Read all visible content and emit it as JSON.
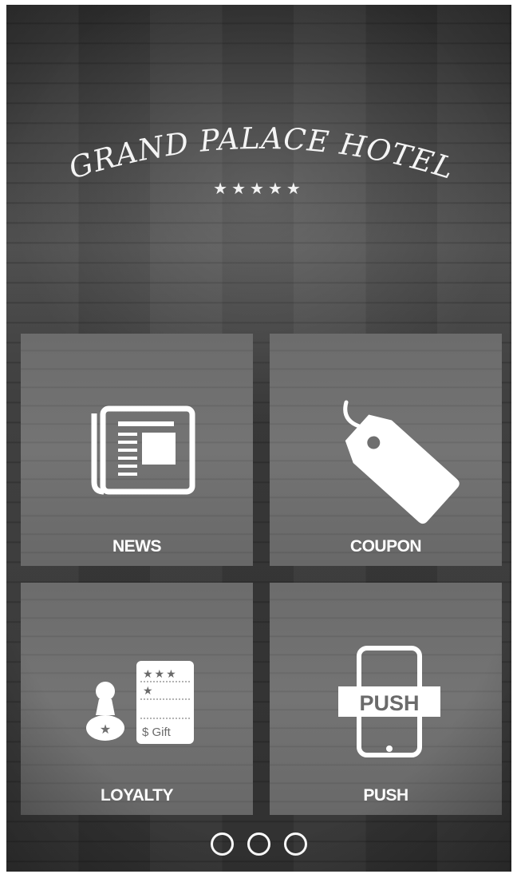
{
  "app": {
    "hotel_name": "GRAND PALACE HOTEL",
    "rating_stars": "★★★★★",
    "rating": 5
  },
  "tiles": [
    {
      "label": "NEWS",
      "icon": "newspaper-icon"
    },
    {
      "label": "COUPON",
      "icon": "tag-icon"
    },
    {
      "label": "LOYALTY",
      "icon": "loyalty-card-stamp-icon",
      "card_stars_row1": "★★★",
      "card_stars_row2": "★",
      "card_text": "$ Gift"
    },
    {
      "label": "PUSH",
      "icon": "phone-push-icon",
      "badge_text": "PUSH"
    }
  ],
  "pager": {
    "page_count": 3,
    "dots": [
      "page-1",
      "page-2",
      "page-3"
    ]
  },
  "colors": {
    "background": "#3a3a3a",
    "tile": "#6f6f6f",
    "text": "#ffffff"
  }
}
